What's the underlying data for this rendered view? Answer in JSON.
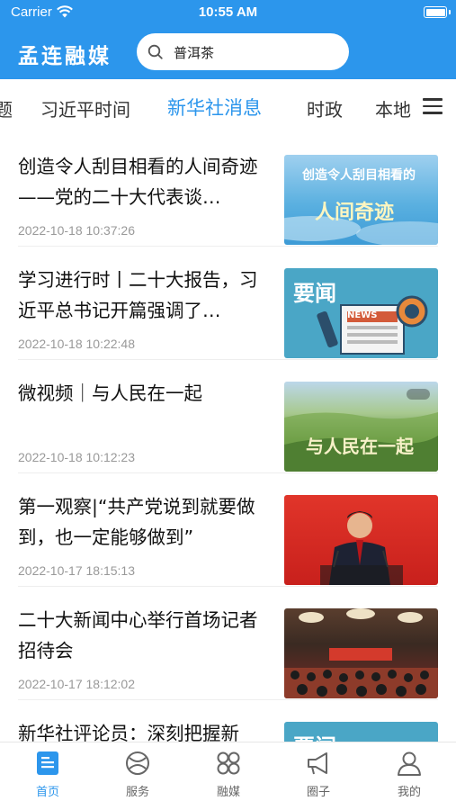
{
  "status": {
    "carrier": "Carrier",
    "time": "10:55 AM"
  },
  "header": {
    "logo": "孟连融媒",
    "search_value": "普洱茶"
  },
  "tabs": [
    "题",
    "习近平时间",
    "新华社消息",
    "时政",
    "本地"
  ],
  "active_tab": "新华社消息",
  "news": [
    {
      "title": "创造令人刮目相看的人间奇迹——党的二十大代表谈…",
      "time": "2022-10-18 10:37:26",
      "thumb_text": [
        "创造令人刮目相看的",
        "人间奇迹"
      ]
    },
    {
      "title": "学习进行时丨二十大报告，习近平总书记开篇强调了…",
      "time": "2022-10-18 10:22:48",
      "thumb_text": [
        "要闻",
        "NEWS"
      ]
    },
    {
      "title": "微视频｜与人民在一起",
      "time": "2022-10-18 10:12:23",
      "thumb_text": [
        "与人民在一起"
      ]
    },
    {
      "title": "第一观察|“共产党说到就要做到，也一定能够做到”",
      "time": "2022-10-17 18:15:13",
      "thumb_text": []
    },
    {
      "title": "二十大新闻中心举行首场记者招待会",
      "time": "2022-10-17 18:12:02",
      "thumb_text": []
    },
    {
      "title": "新华社评论员：深刻把握新",
      "time": "",
      "thumb_text": [
        "要闻"
      ]
    }
  ],
  "bottom_nav": [
    "首页",
    "服务",
    "融媒",
    "圈子",
    "我的"
  ],
  "colors": {
    "brand": "#2c96ec",
    "text": "#111111",
    "muted": "#999999"
  }
}
